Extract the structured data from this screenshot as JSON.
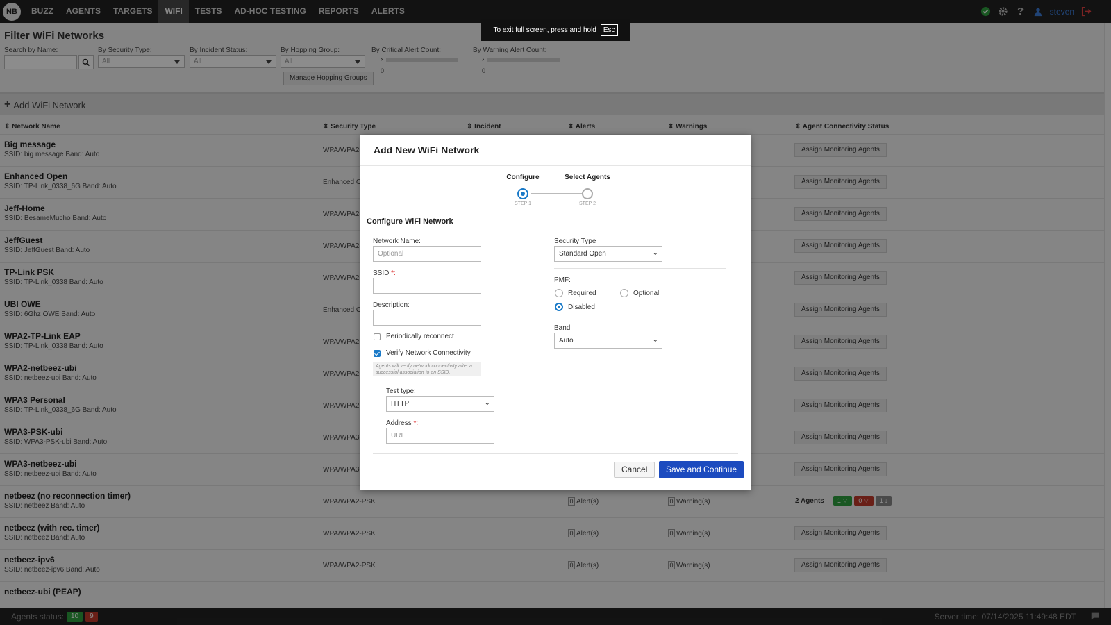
{
  "nav": {
    "logo": "NB",
    "items": [
      "BUZZ",
      "AGENTS",
      "TARGETS",
      "WIFI",
      "TESTS",
      "AD-HOC TESTING",
      "REPORTS",
      "ALERTS"
    ],
    "active": "WIFI",
    "user": "steven"
  },
  "filter": {
    "title": "Filter WiFi Networks",
    "search_label": "Search by Name:",
    "security_label": "By Security Type:",
    "security_value": "All",
    "incident_label": "By Incident Status:",
    "incident_value": "All",
    "hopping_label": "By Hopping Group:",
    "hopping_value": "All",
    "critical_label": "By Critical Alert Count:",
    "critical_value": "0",
    "warning_label": "By Warning Alert Count:",
    "warning_value": "0",
    "manage_button": "Manage Hopping Groups"
  },
  "add_network": "Add WiFi Network",
  "table": {
    "headers": [
      "Network Name",
      "Security Type",
      "Incident",
      "Alerts",
      "Warnings",
      "Agent Connectivity Status"
    ],
    "assign_label": "Assign Monitoring Agents",
    "rows": [
      {
        "name": "Big message",
        "ssid": "SSID: big message Band: Auto",
        "security": "WPA/WPA2-"
      },
      {
        "name": "Enhanced Open",
        "ssid": "SSID: TP-Link_0338_6G Band: Auto",
        "security": "Enhanced Op"
      },
      {
        "name": "Jeff-Home",
        "ssid": "SSID: BesameMucho Band: Auto",
        "security": "WPA/WPA2-"
      },
      {
        "name": "JeffGuest",
        "ssid": "SSID: JeffGuest Band: Auto",
        "security": "WPA/WPA2-"
      },
      {
        "name": "TP-Link PSK",
        "ssid": "SSID: TP-Link_0338 Band: Auto",
        "security": "WPA/WPA2-"
      },
      {
        "name": "UBI OWE",
        "ssid": "SSID: 6Ghz OWE Band: Auto",
        "security": "Enhanced Op"
      },
      {
        "name": "WPA2-TP-Link EAP",
        "ssid": "SSID: TP-Link_0338 Band: Auto",
        "security": "WPA/WPA2-"
      },
      {
        "name": "WPA2-netbeez-ubi",
        "ssid": "SSID: netbeez-ubi Band: Auto",
        "security": "WPA/WPA2-"
      },
      {
        "name": "WPA3 Personal",
        "ssid": "SSID: TP-Link_0338_6G Band: Auto",
        "security": "WPA/WPA2-"
      },
      {
        "name": "WPA3-PSK-ubi",
        "ssid": "SSID: WPA3-PSK-ubi Band: Auto",
        "security": "WPA/WPA3-"
      },
      {
        "name": "WPA3-netbeez-ubi",
        "ssid": "SSID: netbeez-ubi Band: Auto",
        "security": "WPA/WPA3-"
      },
      {
        "name": "netbeez (no reconnection timer)",
        "ssid": "SSID: netbeez Band: Auto",
        "security": "WPA/WPA2-PSK",
        "alerts": "0",
        "alerts_label": "Alert(s)",
        "warnings": "0",
        "warnings_label": "Warning(s)",
        "agents": {
          "label": "2 Agents",
          "up": "1",
          "down": "0",
          "other": "1"
        }
      },
      {
        "name": "netbeez (with rec. timer)",
        "ssid": "SSID: netbeez Band: Auto",
        "security": "WPA/WPA2-PSK",
        "alerts": "0",
        "alerts_label": "Alert(s)",
        "warnings": "0",
        "warnings_label": "Warning(s)"
      },
      {
        "name": "netbeez-ipv6",
        "ssid": "SSID: netbeez-ipv6 Band: Auto",
        "security": "WPA/WPA2-PSK",
        "alerts": "0",
        "alerts_label": "Alert(s)",
        "warnings": "0",
        "warnings_label": "Warning(s)"
      },
      {
        "name": "netbeez-ubi (PEAP)",
        "ssid": "",
        "security": ""
      }
    ]
  },
  "status_bar": {
    "agents_label": "Agents status:",
    "up_count": "10",
    "down_count": "9",
    "server_time": "Server time: 07/14/2025 11:49:48 EDT"
  },
  "toast": {
    "text": "To exit full screen, press and hold",
    "key": "Esc"
  },
  "modal": {
    "title": "Add New WiFi Network",
    "steps": [
      {
        "title": "Configure",
        "sub": "STEP 1"
      },
      {
        "title": "Select Agents",
        "sub": "STEP 2"
      }
    ],
    "section_title": "Configure WiFi Network",
    "network_name_label": "Network Name:",
    "network_name_placeholder": "Optional",
    "ssid_label": "SSID",
    "description_label": "Description:",
    "periodic_label": "Periodically reconnect",
    "verify_label": "Verify Network Connectivity",
    "hint": "Agents will verify network connectivity after a successful association to an SSID.",
    "test_type_label": "Test type:",
    "test_type_value": "HTTP",
    "address_label": "Address",
    "address_placeholder": "URL",
    "security_type_label": "Security Type",
    "security_type_value": "Standard Open",
    "pmf_label": "PMF:",
    "pmf_required": "Required",
    "pmf_optional": "Optional",
    "pmf_disabled": "Disabled",
    "band_label": "Band",
    "band_value": "Auto",
    "cancel": "Cancel",
    "save": "Save and Continue"
  },
  "colors": {
    "primary": "#1c4bbf",
    "accent": "#1a7ac8",
    "nav_bg": "#222222",
    "ok": "#2e9e3e",
    "error": "#c0392b"
  }
}
